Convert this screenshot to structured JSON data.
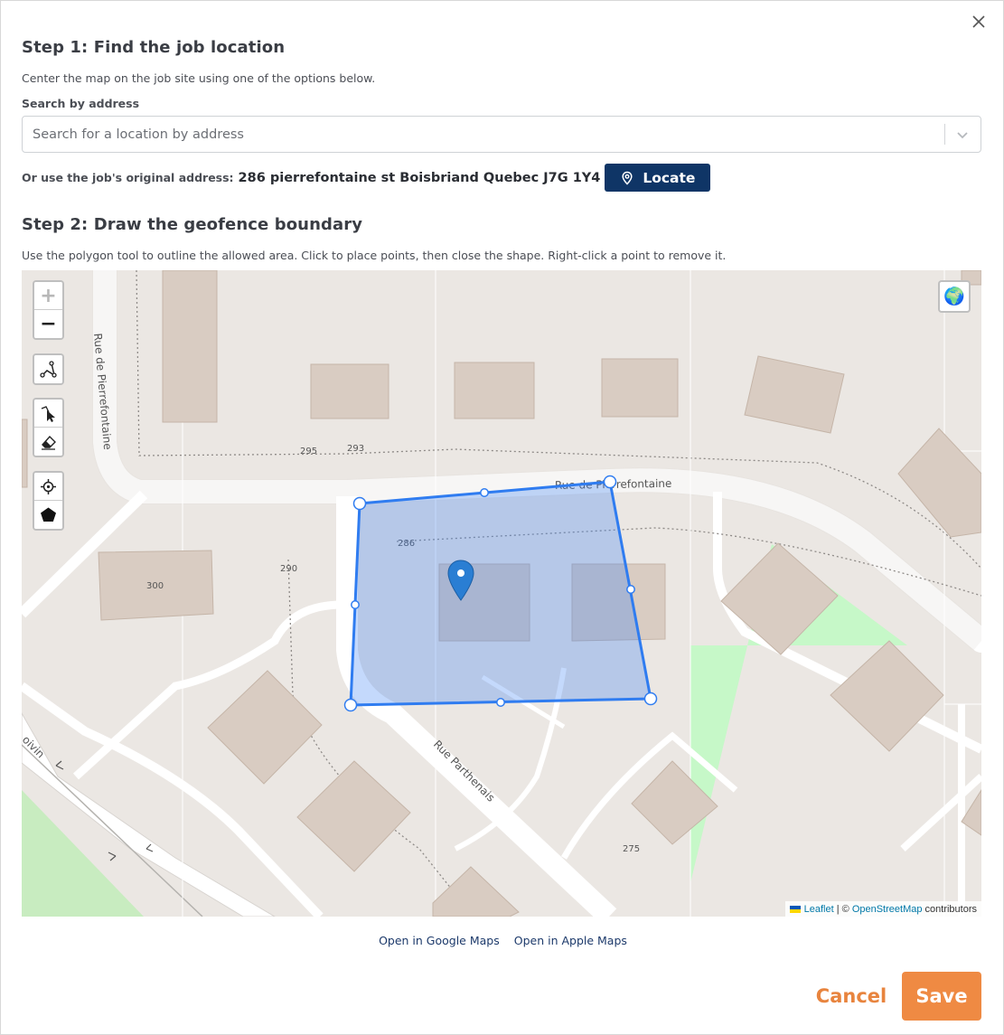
{
  "dialog": {
    "close_label": "×"
  },
  "step1": {
    "title": "Step 1: Find the job location",
    "description": "Center the map on the job site using one of the options below.",
    "search_label": "Search by address",
    "search_placeholder": "Search for a location by address",
    "search_value": "",
    "original_label": "Or use the job's original address:",
    "original_address": "286 pierrefontaine st Boisbriand Quebec J7G 1Y4",
    "locate_label": "Locate"
  },
  "step2": {
    "title": "Step 2: Draw the geofence boundary",
    "description": "Use the polygon tool to outline the allowed area. Click to place points, then close the shape. Right-click a point to remove it."
  },
  "map": {
    "zoom_in": "+",
    "zoom_out": "−",
    "tools": [
      "polyline-tool-icon",
      "edit-pointer-icon",
      "eraser-icon",
      "crosshair-icon",
      "pentagon-icon"
    ],
    "layer_icon": "🌍",
    "streets": [
      "Rue de Pierrefontaine",
      "Rue de Pierrefontaine",
      "Rue Parthenais",
      "oivin"
    ],
    "house_numbers": [
      "295",
      "293",
      "300",
      "290",
      "286",
      "275"
    ],
    "attribution": {
      "leaflet": "Leaflet",
      "separator": " | © ",
      "osm": "OpenStreetMap",
      "suffix": " contributors"
    },
    "geofence_color": "#3b82f6",
    "marker_color": "#2a7ed3"
  },
  "footer": {
    "google_maps": "Open in Google Maps",
    "apple_maps": "Open in Apple Maps",
    "cancel_label": "Cancel",
    "save_label": "Save",
    "accent_color": "#ef8a43",
    "navy_color": "#0f3566"
  }
}
